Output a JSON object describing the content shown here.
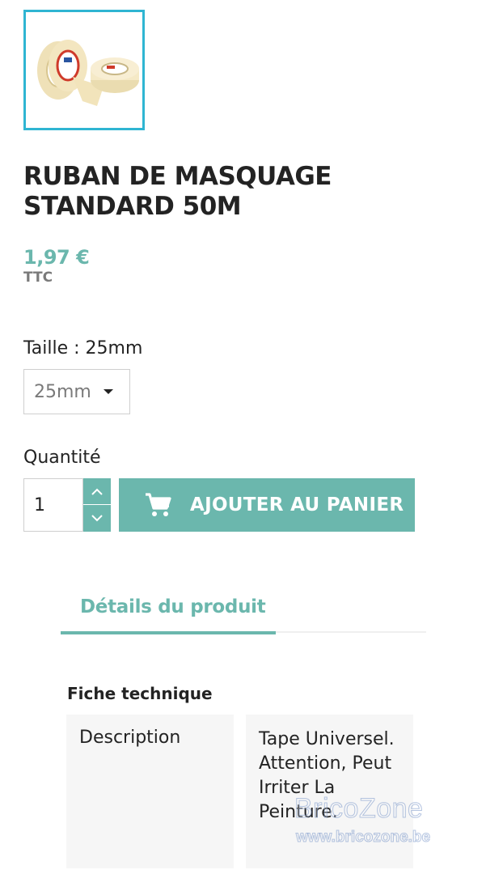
{
  "product": {
    "title": "RUBAN DE MASQUAGE STANDARD 50M",
    "price": "1,97 €",
    "tax_label": "TTC"
  },
  "variant": {
    "label": "Taille : 25mm",
    "selected": "25mm"
  },
  "quantity": {
    "label": "Quantité",
    "value": "1"
  },
  "cart": {
    "add_label": "AJOUTER AU PANIER",
    "icon": "shopping-cart-icon"
  },
  "tabs": [
    {
      "label": "Détails du produit",
      "active": true
    }
  ],
  "datasheet": {
    "title": "Fiche technique",
    "rows": [
      {
        "name": "Description",
        "value": "Tape Universel. Attention, Peut Irriter La Peinture."
      }
    ]
  },
  "watermark": {
    "logo": "BricoZone",
    "url": "www.bricozone.be"
  },
  "colors": {
    "accent": "#6bb7ad",
    "thumb_border": "#2fb5d2"
  }
}
